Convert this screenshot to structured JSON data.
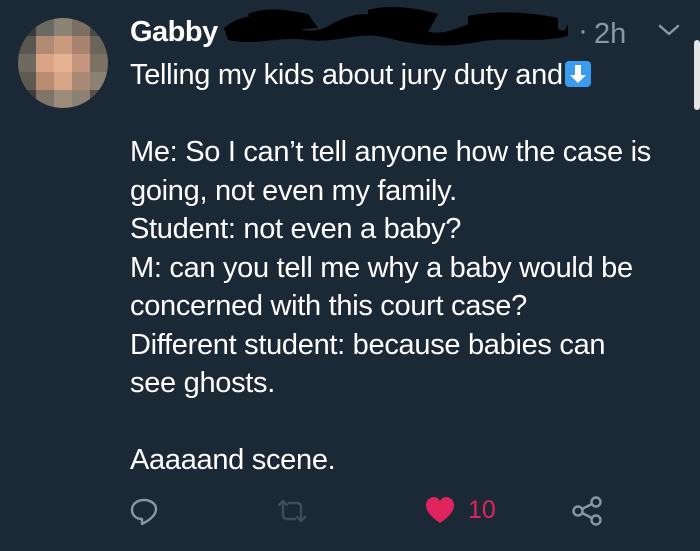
{
  "tweet": {
    "author": "Gabby",
    "dot": "·",
    "time": "2h",
    "lines": [
      "Me: So I can’t tell anyone how the case is",
      "going, not even my family.",
      "Student: not even a baby?",
      "M: can you tell me why a baby would be",
      "concerned with this court case?",
      "Different student: because babies can",
      "see ghosts."
    ],
    "first_line": "Telling my kids about jury duty and",
    "closing": "Aaaaand scene."
  },
  "actions": {
    "like_count": "10",
    "icons": [
      "reply-icon",
      "retweet-icon",
      "heart-icon",
      "share-icon"
    ]
  },
  "colors": {
    "background": "#1b2836",
    "text": "#ffffff",
    "muted": "#8899a6",
    "like": "#e0245e",
    "emoji_blue": "#3b9bef"
  }
}
